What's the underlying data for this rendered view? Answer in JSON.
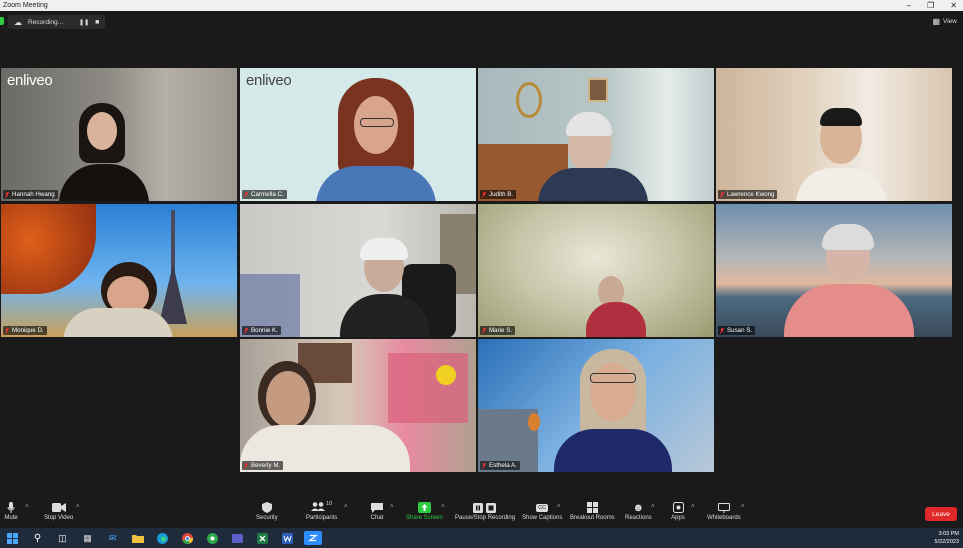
{
  "window": {
    "title": "Zoom Meeting"
  },
  "top": {
    "recording_label": "Recording...",
    "view_label": "View"
  },
  "tiles": [
    {
      "name": "Hannah Hwang",
      "logo": "enliveo"
    },
    {
      "name": "Carmella C.",
      "logo": "enliveo"
    },
    {
      "name": "Judith B."
    },
    {
      "name": "Lawrence Kwong"
    },
    {
      "name": "Monique D."
    },
    {
      "name": "Bonnie K."
    },
    {
      "name": "Marie S."
    },
    {
      "name": "Susan S."
    },
    {
      "name": "Beverly M."
    },
    {
      "name": "Esthela A."
    }
  ],
  "toolbar": {
    "mute": "Mute",
    "stop_video": "Stop Video",
    "security": "Security",
    "participants": "Participants",
    "participants_count": "10",
    "chat": "Chat",
    "share_screen": "Share Screen",
    "pause_recording": "Pause/Stop Recording",
    "captions": "Show Captions",
    "captions_icon_text": "CC",
    "breakout": "Breakout Rooms",
    "reactions": "Reactions",
    "apps": "Apps",
    "whiteboards": "Whiteboards",
    "leave": "Leave"
  },
  "taskbar": {
    "time": "3:03 PM",
    "date": "5/22/2023"
  },
  "colors": {
    "leave": "#e02828",
    "share_green": "#2ecc40",
    "active_speaker": "#c7e84a"
  }
}
